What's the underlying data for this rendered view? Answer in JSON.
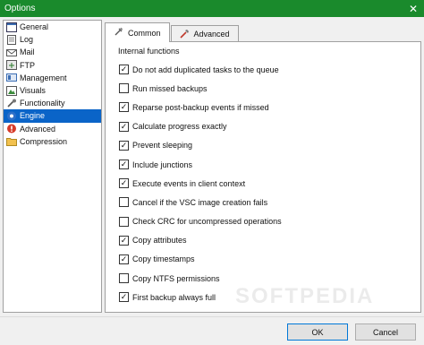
{
  "window": {
    "title": "Options",
    "close_glyph": "✕"
  },
  "sidebar": {
    "items": [
      {
        "label": "General",
        "icon": "general-icon"
      },
      {
        "label": "Log",
        "icon": "log-icon"
      },
      {
        "label": "Mail",
        "icon": "mail-icon"
      },
      {
        "label": "FTP",
        "icon": "ftp-icon"
      },
      {
        "label": "Management",
        "icon": "management-icon"
      },
      {
        "label": "Visuals",
        "icon": "visuals-icon"
      },
      {
        "label": "Functionality",
        "icon": "functionality-icon"
      },
      {
        "label": "Engine",
        "icon": "engine-icon",
        "selected": true
      },
      {
        "label": "Advanced",
        "icon": "advanced-icon"
      },
      {
        "label": "Compression",
        "icon": "compression-icon"
      }
    ]
  },
  "tabs": [
    {
      "label": "Common",
      "active": true
    },
    {
      "label": "Advanced",
      "active": false
    }
  ],
  "group_title": "Internal functions",
  "options": [
    {
      "label": "Do not add duplicated tasks to the queue",
      "checked": true
    },
    {
      "label": "Run missed backups",
      "checked": false
    },
    {
      "label": "Reparse post-backup events if missed",
      "checked": true
    },
    {
      "label": "Calculate progress exactly",
      "checked": true
    },
    {
      "label": "Prevent sleeping",
      "checked": true
    },
    {
      "label": "Include junctions",
      "checked": true
    },
    {
      "label": "Execute events in client context",
      "checked": true
    },
    {
      "label": "Cancel if the VSC image creation fails",
      "checked": false
    },
    {
      "label": "Check CRC for uncompressed operations",
      "checked": false
    },
    {
      "label": "Copy attributes",
      "checked": true
    },
    {
      "label": "Copy timestamps",
      "checked": true
    },
    {
      "label": "Copy NTFS permissions",
      "checked": false
    },
    {
      "label": "First backup always full",
      "checked": true
    }
  ],
  "watermark": "SOFTPEDIA",
  "footer": {
    "ok_label": "OK",
    "cancel_label": "Cancel"
  },
  "colors": {
    "titlebar": "#1a8a2c",
    "selection": "#0a64c8"
  }
}
